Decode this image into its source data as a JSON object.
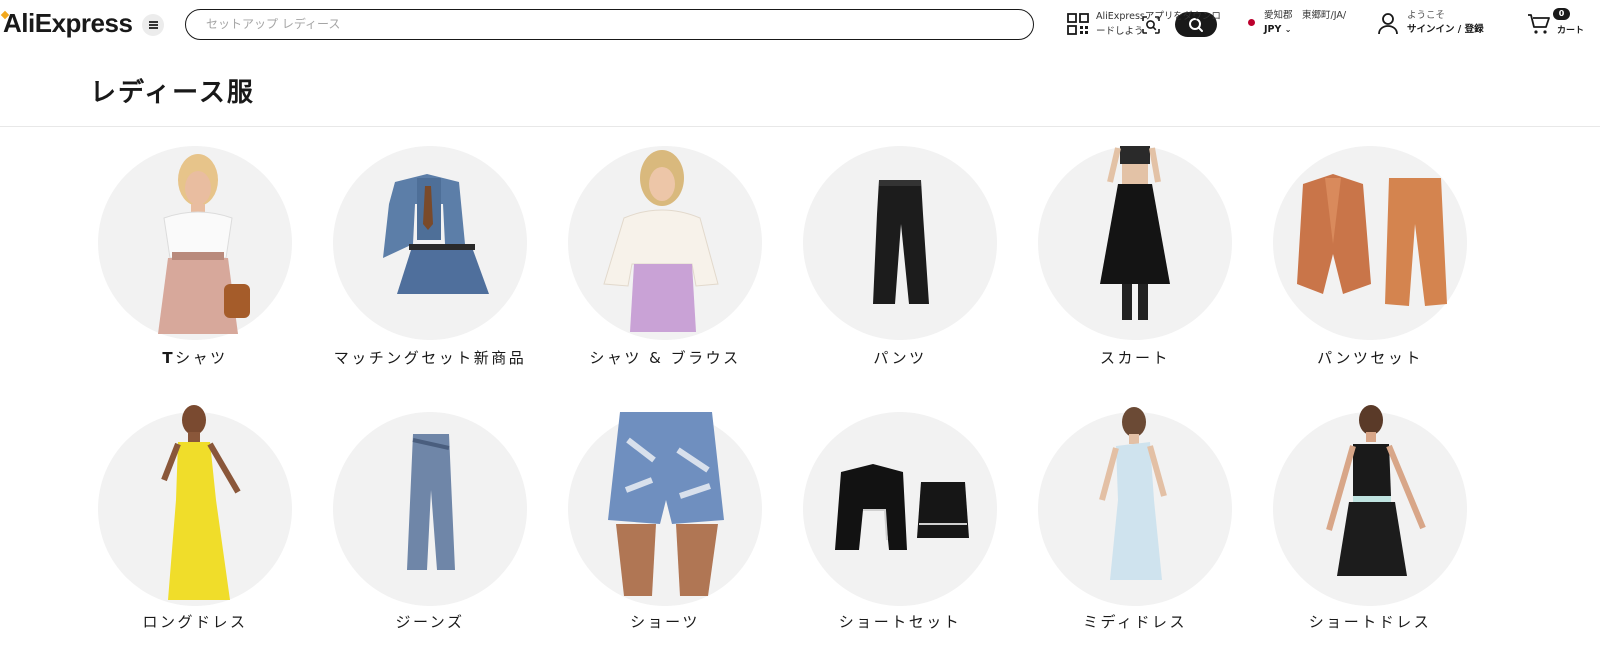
{
  "header": {
    "logo": "AliExpress",
    "search_placeholder": "セットアップ レディース",
    "app_download": "AliExpressアプリをダウンロードしよう",
    "region": "愛知郡　東郷町/JA/",
    "currency": "JPY",
    "welcome": "ようこそ",
    "signin": "サインイン / 登録",
    "cart_count": "0",
    "cart_label": "カート"
  },
  "page": {
    "title": "レディース服"
  },
  "categories": [
    {
      "label": "Tシャツ",
      "icon": "tshirt-model-image"
    },
    {
      "label": "マッチングセット新商品",
      "icon": "denim-set-image"
    },
    {
      "label": "シャツ & ブラウス",
      "icon": "lace-blouse-model-image"
    },
    {
      "label": "パンツ",
      "icon": "black-pants-image"
    },
    {
      "label": "スカート",
      "icon": "black-skirt-model-image"
    },
    {
      "label": "パンツセット",
      "icon": "orange-suit-set-image"
    },
    {
      "label": "ロングドレス",
      "icon": "yellow-dress-model-image"
    },
    {
      "label": "ジーンズ",
      "icon": "jeans-image"
    },
    {
      "label": "ショーツ",
      "icon": "denim-shorts-image"
    },
    {
      "label": "ショートセット",
      "icon": "black-short-set-image"
    },
    {
      "label": "ミディドレス",
      "icon": "light-blue-dress-model-image"
    },
    {
      "label": "ショートドレス",
      "icon": "black-fringe-dress-model-image"
    }
  ],
  "colors": {
    "brand_dark": "#191919",
    "logo_accent": "#f2a81d",
    "circle_bg": "#f2f2f2",
    "flag_red": "#bc002d"
  }
}
